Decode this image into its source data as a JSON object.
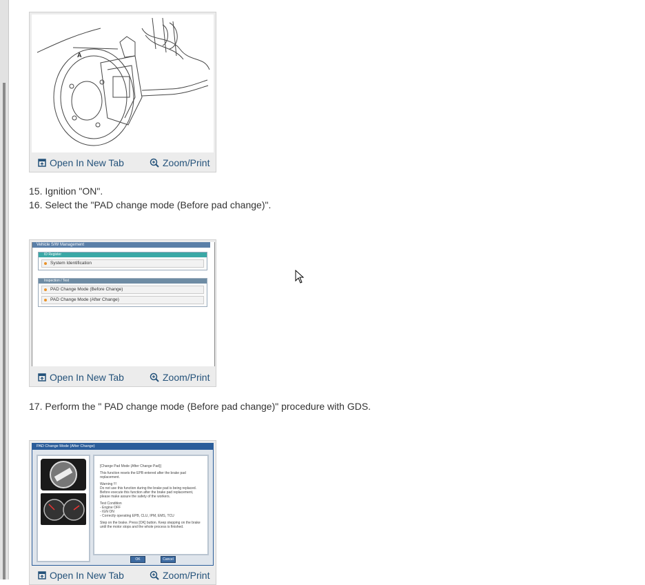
{
  "figures": [
    {
      "open_label": "Open In New Tab",
      "zoom_label": "Zoom/Print",
      "callout": "A"
    },
    {
      "open_label": "Open In New Tab",
      "zoom_label": "Zoom/Print"
    },
    {
      "open_label": "Open In New Tab",
      "zoom_label": "Zoom/Print"
    }
  ],
  "steps": {
    "s15": "15. Ignition \"ON\".",
    "s16": "16. Select the \"PAD change mode (Before pad change)\".",
    "s17": "17. Perform the \" PAD change mode (Before pad change)\" procedure with GDS."
  },
  "gds1": {
    "title": "Vehicle S/W Management",
    "panel1_header": "ID Register",
    "panel1_items": [
      "System Identification"
    ],
    "panel2_header": "Inspection / Test",
    "panel2_items": [
      "PAD Change Mode (Before Change)",
      "PAD Change Mode (After Change)"
    ]
  },
  "gds2": {
    "title": "PAD Change Mode (After Change)",
    "heading": "[Change Pad Mode (After Change Pad)]",
    "para1": "This function resets the EPB entered after the brake pad replacement.",
    "warning_title": "Warning !!!",
    "warning_text": "Do not use this function during the brake pad is being replaced. Before execute this function after the brake pad replacement, please make assure the safety of the workers.",
    "conditions_title": "Test Condition",
    "conditions": [
      "- Engine OFF",
      "- IGN ON",
      "- Correctly operating EPB, CLU, IPM, EMS, TCU"
    ],
    "instructions": "Step on the brake. Press [OK] button. Keep stepping on the brake until the motor stops and the whole process is finished.",
    "ok_label": "OK",
    "cancel_label": "Cancel"
  },
  "colors": {
    "link": "#24527a",
    "accent": "#3aa8a6",
    "window": "#2b5d9a"
  },
  "icons": [
    "open-new-tab-icon",
    "zoom-icon",
    "mouse-cursor-icon"
  ]
}
